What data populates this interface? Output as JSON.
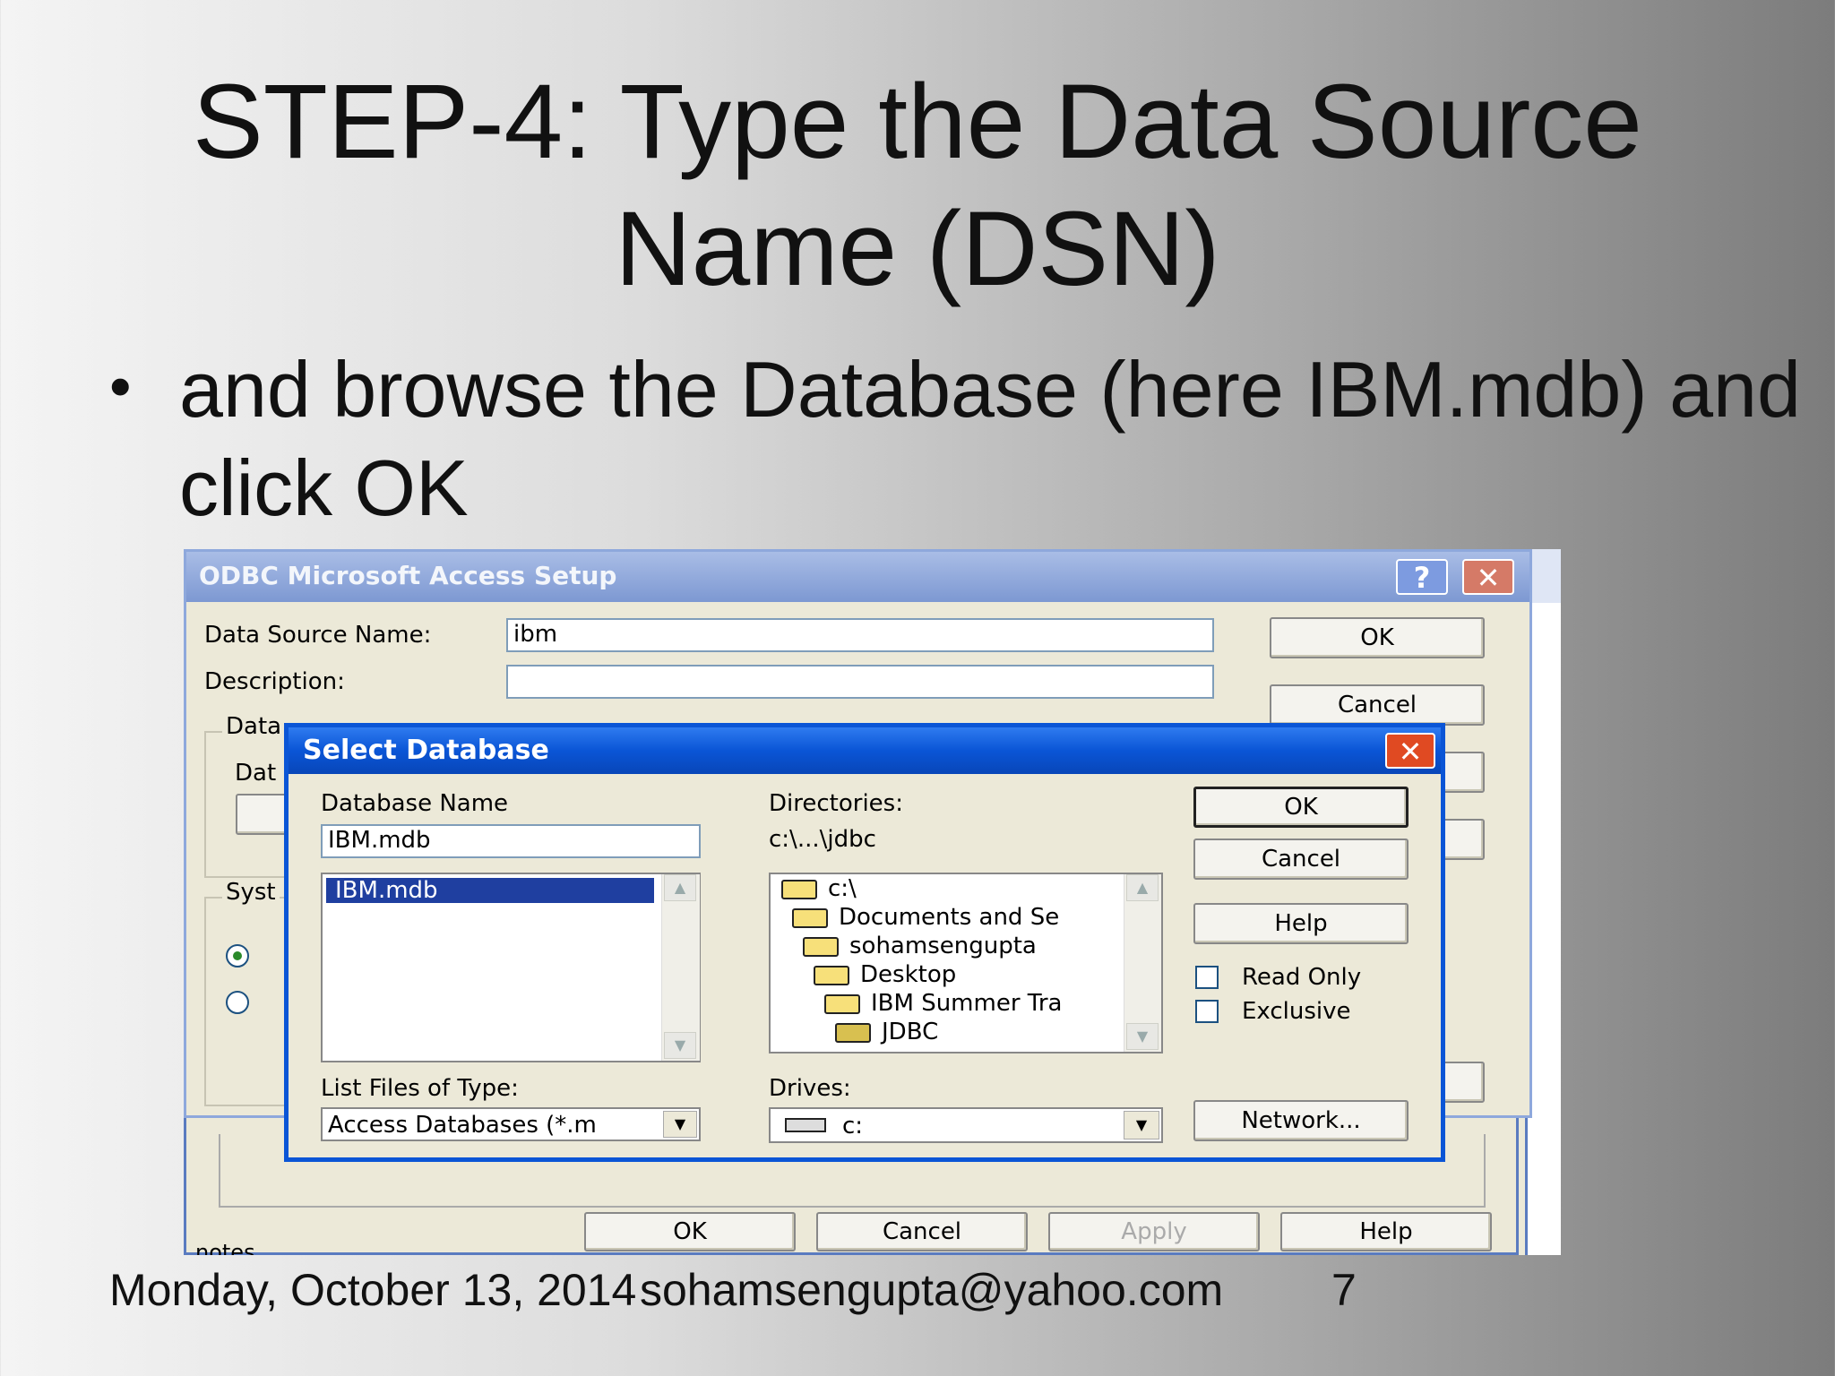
{
  "slide": {
    "title_line1": "STEP-4: Type the Data Source",
    "title_line2": "Name (DSN)",
    "bullet": "and browse the Database (here IBM.mdb) and click OK",
    "footer_date": "Monday, October 13, 2014",
    "footer_email": "sohamsengupta@yahoo.com",
    "footer_page": "7"
  },
  "odbc_dialog": {
    "title": "ODBC Microsoft Access Setup",
    "dsn_label": "Data Source Name:",
    "dsn_value": "ibm",
    "description_label": "Description:",
    "description_value": "",
    "ok_label": "OK",
    "cancel_label": "Cancel",
    "database_group_label": "Data",
    "database_sub_label": "Dat",
    "system_group_label": "Syst"
  },
  "select_db": {
    "title": "Select Database",
    "db_name_label": "Database Name",
    "db_name_value": "IBM.mdb",
    "files": [
      "IBM.mdb"
    ],
    "directories_label": "Directories:",
    "directories_value": "c:\\...\\jdbc",
    "dir_tree": [
      "c:\\",
      "Documents and Se",
      "sohamsengupta",
      "Desktop",
      "IBM Summer Tra",
      "JDBC"
    ],
    "file_type_label": "List Files of Type:",
    "file_type_value": "Access Databases (*.m",
    "drives_label": "Drives:",
    "drive_value": "c:",
    "ok_label": "OK",
    "cancel_label": "Cancel",
    "help_label": "Help",
    "read_only_label": "Read Only",
    "exclusive_label": "Exclusive",
    "network_label": "Network..."
  },
  "back_dialog": {
    "ok_label": "OK",
    "cancel_label": "Cancel",
    "apply_label": "Apply",
    "help_label": "Help",
    "notes_label": "notes"
  },
  "colors": {
    "xp_title_blue": "#0a55d6",
    "xp_inactive_title": "#8ea8dc",
    "dialog_bg": "#ece9d8",
    "close_red": "#e04a22"
  }
}
